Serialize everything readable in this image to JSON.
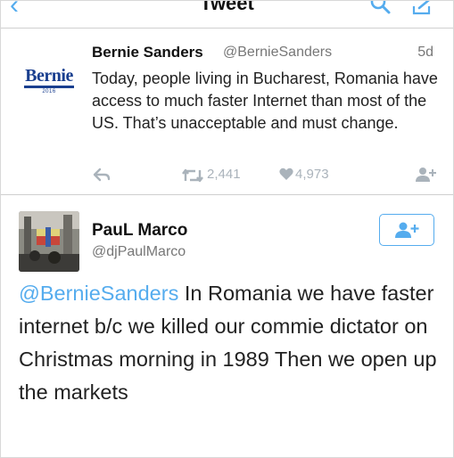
{
  "nav": {
    "title": "Tweet",
    "back_icon": "chevron-left-icon",
    "search_icon": "search-icon",
    "compose_icon": "compose-icon",
    "accent": "#55acee"
  },
  "tweet1": {
    "logo_text": "Bernie",
    "logo_year": "2016",
    "name": "Bernie Sanders",
    "handle": "@BernieSanders",
    "time": "5d",
    "text": "Today, people living in Bucharest, Romania have access to much faster Internet than most of the US. That’s unacceptable and must change.",
    "actions": {
      "reply_icon": "reply-icon",
      "retweet_icon": "retweet-icon",
      "retweet_count": "2,441",
      "like_icon": "heart-icon",
      "like_count": "4,973",
      "follow_icon": "add-user-icon"
    }
  },
  "tweet2": {
    "name": "PauL Marco",
    "handle": "@djPaulMarco",
    "follow_icon": "add-user-icon",
    "mention": "@BernieSanders",
    "text": " In Romania we have faster internet b/c we killed our commie dictator on Christmas morning in 1989  Then we open up the markets"
  }
}
